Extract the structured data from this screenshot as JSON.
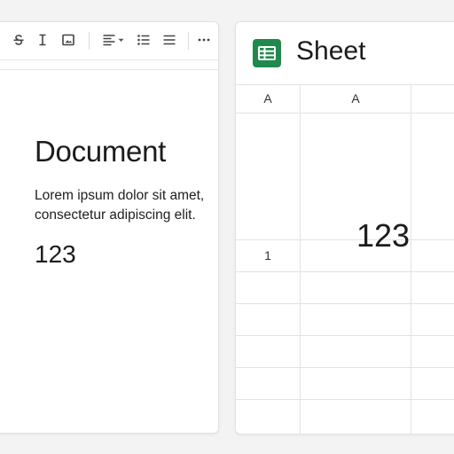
{
  "document": {
    "toolbar": {
      "tools": [
        {
          "name": "strikethrough",
          "icon": "strikethrough-icon"
        },
        {
          "name": "text-cursor",
          "icon": "text-cursor-icon"
        },
        {
          "name": "insert-image",
          "icon": "image-icon"
        },
        {
          "name": "align",
          "icon": "align-left-icon"
        },
        {
          "name": "bulleted-list",
          "icon": "bulleted-list-icon"
        },
        {
          "name": "line-spacing",
          "icon": "lines-icon"
        },
        {
          "name": "more",
          "icon": "more-horizontal-icon"
        }
      ]
    },
    "title": "Document",
    "body": "Lorem ipsum dolor sit amet, consectetur adipiscing elit.",
    "number": "123"
  },
  "sheet": {
    "title": "Sheet",
    "logo_color": "#1f8a4c",
    "column_headers": [
      "A",
      "A"
    ],
    "row_header": "1",
    "cell_value": "123"
  }
}
